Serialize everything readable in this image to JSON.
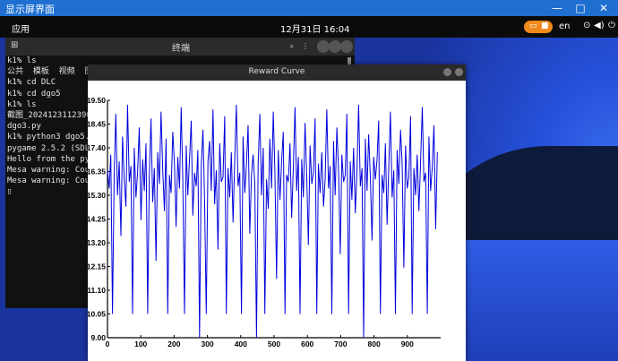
{
  "vnc_window": {
    "title": "显示屏界面",
    "minimize": "—",
    "maximize": "□",
    "close": "✕"
  },
  "topbar": {
    "apps_label": "应用",
    "clock": "12月31日  16:04",
    "lang": "en"
  },
  "terminal": {
    "title": "终端",
    "lines": [
      "k1% ls",
      "公共  模板  视频  图",
      "k1% cd DLC",
      "k1% cd dgo5",
      "k1% ls",
      "截图_20241231123901",
      "dgo3.py",
      "k1% python3 dgo5.py",
      "pygame 2.5.2 (SDL 2",
      "Hello from the pyga",
      "Mesa warning: Coul",
      "Mesa warning: Coul",
      "▯"
    ]
  },
  "plot_window": {
    "title": "Reward Curve"
  },
  "chart_data": {
    "type": "line",
    "title": "",
    "xlabel": "",
    "ylabel": "",
    "xlim": [
      0,
      1000
    ],
    "ylim": [
      9.0,
      19.5
    ],
    "x_ticks": [
      "0",
      "100",
      "200",
      "300",
      "400",
      "500",
      "600",
      "700",
      "800",
      "900"
    ],
    "y_ticks": [
      "9.00",
      "10.05",
      "11.10",
      "12.15",
      "13.20",
      "14.25",
      "15.30",
      "16.35",
      "17.40",
      "18.45",
      "19.50"
    ],
    "line_color": "#0000dd",
    "grid": false,
    "series": [
      {
        "values": [
          16.4,
          15.6,
          17.1,
          10.05,
          16.2,
          18.9,
          15.3,
          16.8,
          13.5,
          17.9,
          16.0,
          14.8,
          19.3,
          15.9,
          16.6,
          10.05,
          17.4,
          15.2,
          16.3,
          18.3,
          14.2,
          16.9,
          15.5,
          17.6,
          10.05,
          16.1,
          18.7,
          15.0,
          16.5,
          12.4,
          17.2,
          15.8,
          19.0,
          16.4,
          14.6,
          17.8,
          10.05,
          16.2,
          15.4,
          18.1,
          16.7,
          13.9,
          17.0,
          15.6,
          19.2,
          16.0,
          10.05,
          17.5,
          15.3,
          16.9,
          18.6,
          14.4,
          16.3,
          15.7,
          17.3,
          9.0,
          16.6,
          18.2,
          15.1,
          10.05,
          16.8,
          17.7,
          15.5,
          19.1,
          14.9,
          16.4,
          12.9,
          17.6,
          15.9,
          16.1,
          18.8,
          10.05,
          16.5,
          15.2,
          17.2,
          14.1,
          16.9,
          19.3,
          15.7,
          16.3,
          10.05,
          17.9,
          15.4,
          16.7,
          18.4,
          13.6,
          16.2,
          17.1,
          15.8,
          9.0,
          16.6,
          18.9,
          15.3,
          17.4,
          10.05,
          16.0,
          14.7,
          17.8,
          15.6,
          19.0,
          16.4,
          11.6,
          17.3,
          15.1,
          16.8,
          18.1,
          10.05,
          16.2,
          15.9,
          17.6,
          14.3,
          16.5,
          19.2,
          15.5,
          17.0,
          10.05,
          16.9,
          15.2,
          18.5,
          16.1,
          13.1,
          17.5,
          15.8,
          16.3,
          18.7,
          10.05,
          16.7,
          15.4,
          17.2,
          14.8,
          16.0,
          19.1,
          15.6,
          16.6,
          10.05,
          17.7,
          15.3,
          18.3,
          16.4,
          12.7,
          17.1,
          15.9,
          16.2,
          18.9,
          10.05,
          16.8,
          15.1,
          17.4,
          14.5,
          16.3,
          19.3,
          15.7,
          16.5,
          9.0,
          17.8,
          15.5,
          18.0,
          16.1,
          13.3,
          17.0,
          16.0,
          16.9,
          18.6,
          10.05,
          16.2,
          15.4,
          17.6,
          14.0,
          16.6,
          19.0,
          15.2,
          16.4,
          10.05,
          17.3,
          15.8,
          18.2,
          16.7,
          12.1,
          17.5,
          15.6,
          16.1,
          18.8,
          10.05,
          16.5,
          15.3,
          17.1,
          14.6,
          16.8,
          19.2,
          15.9,
          16.3,
          10.05,
          17.9,
          15.5,
          16.6,
          18.4,
          13.8,
          17.2
        ]
      }
    ]
  }
}
